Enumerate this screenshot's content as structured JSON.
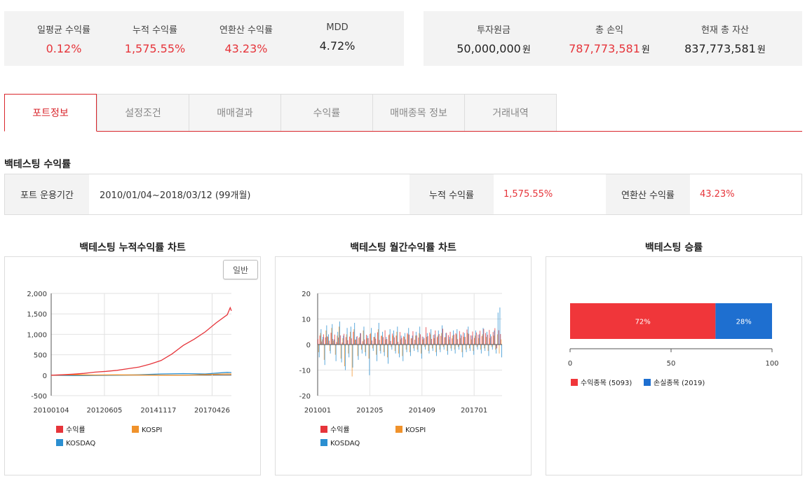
{
  "summary_left": [
    {
      "label": "일평균 수익률",
      "value": "0.12%",
      "color": "#e6343a"
    },
    {
      "label": "누적 수익률",
      "value": "1,575.55%",
      "color": "#e6343a"
    },
    {
      "label": "연환산 수익률",
      "value": "43.23%",
      "color": "#e6343a"
    },
    {
      "label": "MDD",
      "value": "4.72%",
      "color": "#222222"
    }
  ],
  "summary_right": [
    {
      "label": "투자원금",
      "value": "50,000,000",
      "unit": "원",
      "color": "#222222"
    },
    {
      "label": "총 손익",
      "value": "787,773,581",
      "unit": "원",
      "color": "#e6343a"
    },
    {
      "label": "현재 총 자산",
      "value": "837,773,581",
      "unit": "원",
      "color": "#222222"
    }
  ],
  "tabs": [
    "포트정보",
    "설정조건",
    "매매결과",
    "수익률",
    "매매종목 정보",
    "거래내역"
  ],
  "active_tab": "포트정보",
  "section_title": "백테스팅 수익률",
  "info": {
    "period_label": "포트 운용기간",
    "period_value": "2010/01/04~2018/03/12 (99개월)",
    "cum_label": "누적 수익률",
    "cum_value": "1,575.55%",
    "ann_label": "연환산 수익률",
    "ann_value": "43.23%"
  },
  "chart1_title": "백테스팅 누적수익률 차트",
  "chart2_title": "백테스팅 월간수익률 차트",
  "chart3_title": "백테스팅 승률",
  "chart1_button": "일반",
  "colors": {
    "accent": "#d9262c",
    "series_return": "#e6343a",
    "series_kospi": "#f0922b",
    "series_kosdaq": "#2b8fd1",
    "win": "#f0363a",
    "loss": "#1e6fd0"
  },
  "chart_data": [
    {
      "type": "line",
      "title": "백테스팅 누적수익률 차트",
      "x_ticks": [
        "20100104",
        "20120605",
        "20141117",
        "20170426"
      ],
      "y_ticks": [
        "2,000",
        "1,500",
        "1,000",
        "500",
        "0",
        "-500"
      ],
      "ylim": [
        -500,
        2000
      ],
      "x_range": [
        "20100104",
        "20180312"
      ],
      "series": [
        {
          "name": "수익률",
          "x": [
            "20100104",
            "20100701",
            "20110103",
            "20110701",
            "20120102",
            "20120702",
            "20130102",
            "20130701",
            "20140102",
            "20140701",
            "20150102",
            "20150701",
            "20160104",
            "20160701",
            "20170102",
            "20170703",
            "20180102",
            "20180220",
            "20180312"
          ],
          "y": [
            0,
            10,
            25,
            45,
            75,
            95,
            120,
            160,
            200,
            270,
            360,
            520,
            730,
            880,
            1060,
            1280,
            1480,
            1650,
            1575
          ]
        },
        {
          "name": "KOSPI",
          "x": [
            "20100104",
            "20110103",
            "20120102",
            "20130102",
            "20140102",
            "20150102",
            "20160104",
            "20170102",
            "20180102",
            "20180312"
          ],
          "y": [
            0,
            10,
            5,
            8,
            5,
            2,
            -2,
            15,
            30,
            28
          ]
        },
        {
          "name": "KOSDAQ",
          "x": [
            "20100104",
            "20110103",
            "20120102",
            "20130102",
            "20140102",
            "20150102",
            "20160104",
            "20170102",
            "20180102",
            "20180312"
          ],
          "y": [
            0,
            -10,
            -5,
            0,
            10,
            30,
            40,
            30,
            70,
            65
          ]
        }
      ],
      "legend": [
        "수익률",
        "KOSPI",
        "KOSDAQ"
      ],
      "legend_placement": "bottom",
      "grid": true
    },
    {
      "type": "bar",
      "title": "백테스팅 월간수익률 차트",
      "x_ticks": [
        "201001",
        "201205",
        "201409",
        "201701"
      ],
      "y_ticks": [
        "20",
        "10",
        "0",
        "-10",
        "-20"
      ],
      "ylim": [
        -20,
        20
      ],
      "x_range": [
        "201001",
        "201803"
      ],
      "series": [
        {
          "name": "수익률",
          "values": [
            2.1,
            3.5,
            1.2,
            4.0,
            2.8,
            3.2,
            1.5,
            4.6,
            2.2,
            3.9,
            1.0,
            2.7,
            3.6,
            0.8,
            4.2,
            2.9,
            1.7,
            3.1,
            2.4,
            5.0,
            1.9,
            3.3,
            2.6,
            4.4,
            1.3,
            2.0,
            3.8,
            2.5,
            4.1,
            1.6,
            3.0,
            2.3,
            4.8,
            1.8,
            3.4,
            2.9,
            5.6,
            2.2,
            3.7,
            1.4,
            4.3,
            2.8,
            3.5,
            1.1,
            4.9,
            2.6,
            3.2,
            2.0,
            4.5,
            3.9,
            2.4,
            5.2,
            1.9,
            3.6,
            2.7,
            4.0,
            3.1,
            2.5,
            6.8,
            3.3,
            4.7,
            2.2,
            3.8,
            5.5,
            2.9,
            4.1,
            3.4,
            6.2,
            2.8,
            4.6,
            3.7,
            5.0,
            2.4,
            3.9,
            4.4,
            2.1,
            5.3,
            3.5,
            4.8,
            3.0,
            5.9,
            4.2,
            3.6,
            5.1,
            2.6,
            4.7,
            3.9,
            5.4,
            3.3,
            6.1,
            4.5,
            3.8,
            5.7,
            3.2,
            4.9,
            6.4,
            -1.5,
            5.6,
            4.1
          ]
        },
        {
          "name": "KOSPI",
          "values": [
            -3.0,
            4.5,
            2.0,
            -6.0,
            5.5,
            3.0,
            -2.5,
            6.5,
            1.5,
            -4.0,
            3.5,
            7.0,
            -5.5,
            2.5,
            -8.5,
            4.0,
            -3.5,
            5.0,
            -12.5,
            6.0,
            2.0,
            -4.5,
            3.0,
            -2.0,
            5.5,
            -3.0,
            2.5,
            -5.5,
            4.5,
            -1.5,
            3.0,
            -4.0,
            6.0,
            -2.5,
            3.5,
            -3.0,
            2.0,
            -5.0,
            4.0,
            -1.0,
            3.5,
            -2.5,
            5.0,
            -3.5,
            2.0,
            -4.5,
            3.0,
            -2.0,
            4.0,
            -3.0,
            2.5,
            -1.5,
            3.5,
            -2.0,
            4.5,
            -3.5,
            2.0,
            -1.0,
            3.0,
            -2.5,
            4.0,
            -1.5,
            2.5,
            -3.0,
            3.5,
            -2.0,
            4.5,
            -1.0,
            3.0,
            -2.5,
            2.0,
            -1.5,
            3.5,
            -2.0,
            4.0,
            -1.0,
            2.5,
            -3.0,
            3.0,
            -2.0,
            4.5,
            -1.5,
            2.0,
            -2.5,
            3.5,
            -1.0,
            2.5,
            -2.0,
            4.0,
            -1.5,
            3.0,
            -2.5,
            2.5,
            -1.0,
            3.5,
            -2.0,
            4.0,
            -3.5,
            2.0
          ]
        },
        {
          "name": "KOSDAQ",
          "values": [
            -5.0,
            6.0,
            3.0,
            -8.0,
            7.5,
            4.0,
            -3.5,
            8.0,
            2.0,
            -6.5,
            5.0,
            9.0,
            -7.0,
            3.5,
            -10.0,
            6.5,
            -5.0,
            7.0,
            -9.0,
            8.5,
            3.0,
            -6.0,
            4.5,
            -3.5,
            7.0,
            -4.5,
            3.5,
            -12.0,
            6.5,
            -2.5,
            4.5,
            -6.5,
            8.5,
            -3.5,
            5.0,
            -4.5,
            3.0,
            -7.5,
            6.0,
            -2.0,
            5.5,
            -3.5,
            7.0,
            -5.0,
            3.5,
            -6.5,
            4.5,
            -3.0,
            6.5,
            -4.5,
            3.5,
            -2.5,
            5.0,
            -3.0,
            7.0,
            -5.5,
            3.0,
            -2.0,
            4.5,
            -3.5,
            6.0,
            -2.5,
            4.0,
            -4.5,
            5.5,
            -3.0,
            7.5,
            -2.0,
            4.5,
            -4.0,
            3.0,
            -2.5,
            5.5,
            -3.5,
            6.0,
            -2.0,
            4.0,
            -5.0,
            4.5,
            -3.0,
            7.0,
            -2.5,
            3.5,
            -4.0,
            5.5,
            -2.0,
            4.0,
            -3.5,
            6.5,
            -2.5,
            5.0,
            -4.5,
            4.0,
            -2.0,
            5.5,
            -3.5,
            12.5,
            14.5,
            -5.0
          ]
        }
      ],
      "legend": [
        "수익률",
        "KOSPI",
        "KOSDAQ"
      ],
      "legend_placement": "bottom",
      "grid": true
    },
    {
      "type": "bar",
      "title": "백테스팅 승률",
      "orientation": "horizontal-stacked",
      "series": [
        {
          "name": "수익종목 (5093)",
          "value": 72,
          "label": "72%"
        },
        {
          "name": "손실종목 (2019)",
          "value": 28,
          "label": "28%"
        }
      ],
      "x_ticks": [
        "0",
        "50",
        "100"
      ],
      "xlim": [
        0,
        100
      ],
      "legend": [
        "수익종목 (5093)",
        "손실종목 (2019)"
      ],
      "legend_placement": "bottom"
    }
  ]
}
